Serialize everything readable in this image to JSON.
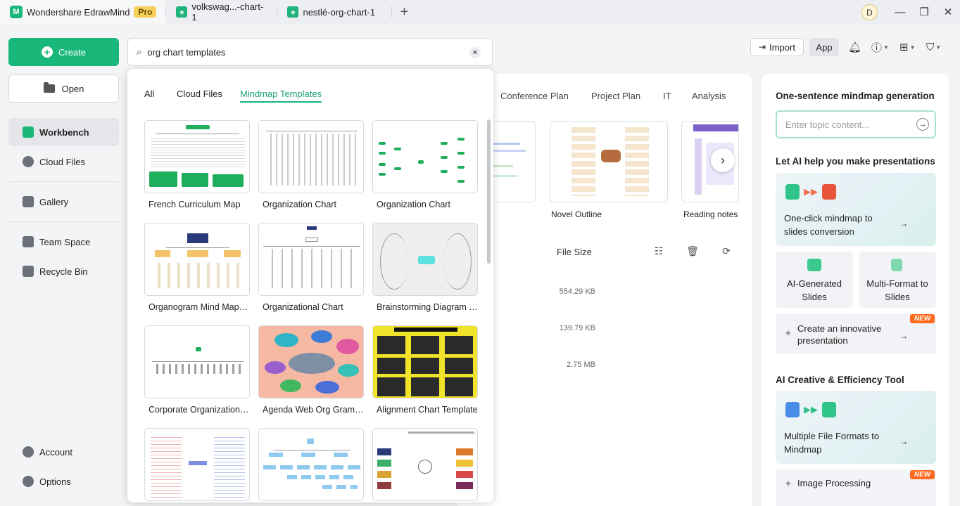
{
  "titlebar": {
    "app_name": "Wondershare EdrawMind",
    "pro_label": "Pro",
    "tabs": [
      {
        "label": "volkswag...-chart-1"
      },
      {
        "label": "nestlé-org-chart-1"
      }
    ],
    "avatar_letter": "D"
  },
  "sidebar": {
    "create_label": "Create",
    "open_label": "Open",
    "items": [
      {
        "label": "Workbench"
      },
      {
        "label": "Cloud Files"
      },
      {
        "label": "Gallery"
      },
      {
        "label": "Team Space"
      },
      {
        "label": "Recycle Bin"
      },
      {
        "label": "Account"
      },
      {
        "label": "Options"
      }
    ]
  },
  "toolbar": {
    "import_label": "Import",
    "app_label": "App"
  },
  "search": {
    "value": "org chart templates"
  },
  "dropdown": {
    "tabs": [
      {
        "label": "All"
      },
      {
        "label": "Cloud Files"
      },
      {
        "label": "Mindmap Templates"
      }
    ],
    "templates": [
      {
        "label": "French Curriculum Map"
      },
      {
        "label": "Organization Chart"
      },
      {
        "label": "Organization Chart"
      },
      {
        "label": "Organogram Mind Map T..."
      },
      {
        "label": "Organizational Chart"
      },
      {
        "label": "Brainstorming Diagram T..."
      },
      {
        "label": "Corporate Organizational..."
      },
      {
        "label": "Agenda Web Org Gramm..."
      },
      {
        "label": "Alignment Chart Template"
      }
    ]
  },
  "main": {
    "categories": [
      {
        "label": "Conference Plan"
      },
      {
        "label": "Project Plan"
      },
      {
        "label": "IT"
      },
      {
        "label": "Analysis"
      }
    ],
    "thumbs": [
      {
        "label": "Novel Outline"
      },
      {
        "label": "Reading notes"
      }
    ],
    "file_size_header": "File Size",
    "file_sizes": [
      "554.29 KB",
      "139.79 KB",
      "2.75 MB"
    ]
  },
  "ai_panel": {
    "one_sentence_title": "One-sentence mindmap generation",
    "topic_placeholder": "Enter topic content...",
    "presentations_title": "Let AI help you make presentations",
    "one_click_label": "One-click mindmap to slides conversion",
    "ai_slides_label": "AI-Generated Slides",
    "multi_format_label": "Multi-Format to Slides",
    "innovative_label": "Create an innovative presentation",
    "new_badge": "NEW",
    "creative_title": "AI Creative & Efficiency Tool",
    "multiple_formats_label": "Multiple File Formats to Mindmap",
    "image_processing_label": "Image Processing"
  },
  "colors": {
    "brand_green": "#19b77a",
    "new_badge": "#ff6a1f",
    "pro_badge": "#f7cf5b"
  }
}
